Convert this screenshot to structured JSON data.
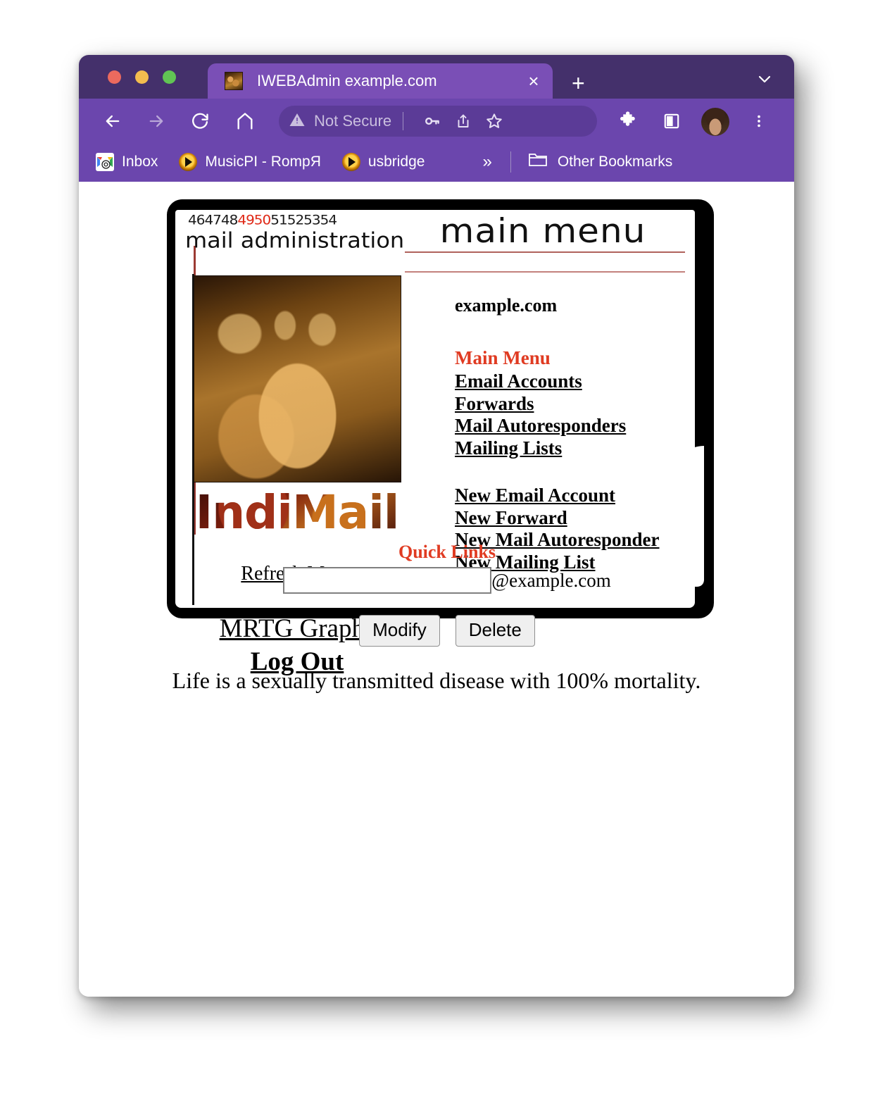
{
  "window": {
    "traffic_lights": [
      "close",
      "minimize",
      "maximize"
    ],
    "tab": {
      "title": "IWEBAdmin example.com",
      "favicon": "indus-seal-icon",
      "close_label": "×"
    },
    "new_tab_label": "+",
    "tab_list_label": "⌄"
  },
  "toolbar": {
    "back_label": "back-icon",
    "forward_label": "forward-icon",
    "reload_label": "reload-icon",
    "home_label": "home-icon",
    "omnibox": {
      "security_text": "Not Secure",
      "security_icon": "warning-triangle-icon",
      "key_icon": "key-icon",
      "share_icon": "share-icon",
      "star_icon": "star-icon"
    },
    "extensions_label": "puzzle-piece-icon",
    "side_panel_label": "side-panel-icon",
    "profile_label": "avatar",
    "menu_label": "⋮"
  },
  "bookmarks": {
    "items": [
      {
        "label": "Inbox",
        "icon": "gmail-icon"
      },
      {
        "label": "MusicPI - RompЯ",
        "icon": "play-icon"
      },
      {
        "label": "usbridge",
        "icon": "play-icon"
      }
    ],
    "overflow_label": "»",
    "other_bookmarks_label": "Other Bookmarks",
    "other_bookmarks_icon": "folder-icon"
  },
  "page": {
    "header": {
      "sequence_prefix": "464748",
      "sequence_highlight": "4950",
      "sequence_suffix": "51525354",
      "subtitle": "mail administration",
      "title": "main menu"
    },
    "left": {
      "logo_alt": "indus-seal-image",
      "wordmark": "IndiMail",
      "refresh_label": "Refresh Menu",
      "mrtg_label": "MRTG Graphs",
      "logout_label": "Log Out"
    },
    "right": {
      "domain": "example.com",
      "menu_heading": "Main Menu",
      "menu_links": [
        "Email Accounts",
        "Forwards",
        "Mail Autoresponders",
        "Mailing Lists"
      ],
      "new_links": [
        "New Email Account",
        "New Forward",
        "New Mail Autoresponder",
        "New Mailing List"
      ]
    },
    "quick_links": {
      "heading": "Quick Links",
      "input_value": "",
      "input_placeholder": "",
      "domain_suffix": "@example.com",
      "modify_label": "Modify",
      "delete_label": "Delete"
    },
    "quote": "Life is a sexually transmitted disease with 100% mortality."
  },
  "colors": {
    "titlebar": "#44306b",
    "toolbar": "#6b46ad",
    "tab_active": "#7a4fb6",
    "accent_red": "#e03b22",
    "rule_red": "#b0625c"
  }
}
